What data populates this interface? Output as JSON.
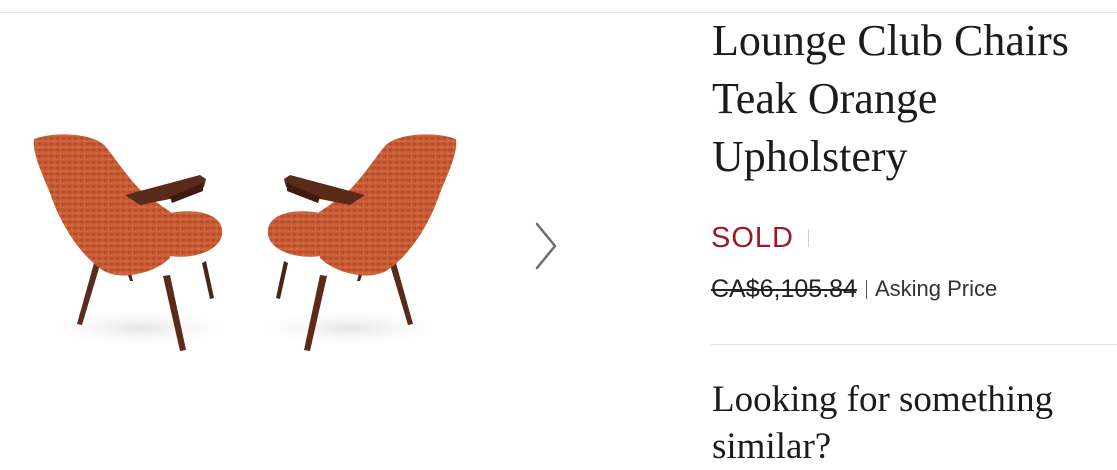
{
  "product": {
    "title": "Lounge Club Chairs Teak Orange Upholstery",
    "status": "SOLD",
    "price": "CA$6,105.84",
    "price_label": "Asking Price"
  },
  "gallery": {
    "next_icon": "chevron-right-icon"
  },
  "recommendations": {
    "heading": "Looking for something similar?"
  },
  "colors": {
    "sold": "#9d1a24",
    "upholstery": "#c65a34",
    "teak": "#5a2a1a"
  }
}
